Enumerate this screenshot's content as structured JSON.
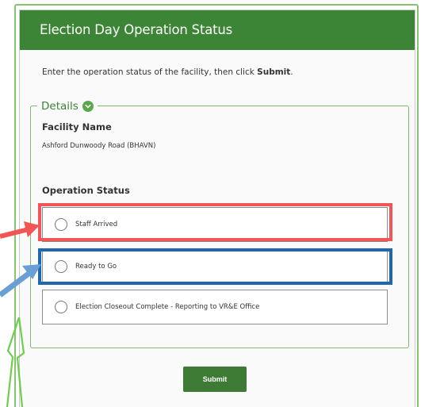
{
  "header": {
    "title": "Election Day Operation Status"
  },
  "instructions": {
    "before": "Enter the operation status of the facility, then click ",
    "bold": "Submit",
    "after": "."
  },
  "details": {
    "legend": "Details",
    "facility_label": "Facility Name",
    "facility_value": "Ashford Dunwoody Road (BHAVN)",
    "status_label": "Operation Status",
    "options": [
      {
        "label": "Staff Arrived",
        "selected": false
      },
      {
        "label": "Ready to Go",
        "selected": false
      },
      {
        "label": "Election Closeout Complete - Reporting to VR&E Office",
        "selected": false
      }
    ]
  },
  "submit": {
    "label": "Submit"
  },
  "colors": {
    "header_green": "#3d8536",
    "highlight_red": "#f25556",
    "highlight_blue": "#1e67b0",
    "arrow_green": "#6ccf4a"
  }
}
